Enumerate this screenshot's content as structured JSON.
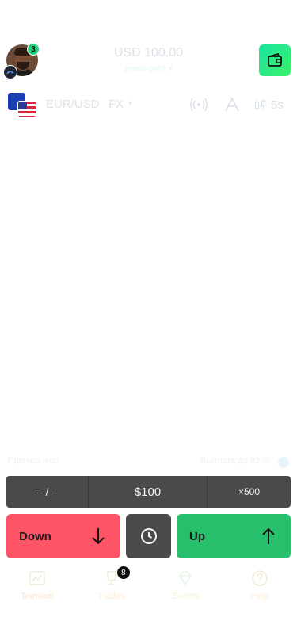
{
  "header": {
    "level_badge": "3",
    "balance": "USD 100.00",
    "account_label": "демо-счёт ▾"
  },
  "asset": {
    "pair": "EUR/USD",
    "type": "FX",
    "candle_interval": "5s"
  },
  "info": {
    "left": "Прогноз итог",
    "right": "Выплата до 92 %"
  },
  "trade": {
    "time": "– / –",
    "amount": "$100",
    "multiplier": "×500",
    "down_label": "Down",
    "up_label": "Up"
  },
  "nav": {
    "items": [
      {
        "label": "Terminal",
        "icon": "chart-icon"
      },
      {
        "label": "Trades",
        "icon": "trophy-icon",
        "badge": "8"
      },
      {
        "label": "Events",
        "icon": "diamond-icon"
      },
      {
        "label": "Help",
        "icon": "help-icon"
      }
    ]
  },
  "colors": {
    "down": "#ff5366",
    "up": "#27be6c",
    "params_bg": "#4a4a4a",
    "wallet": "#18e5a0"
  }
}
